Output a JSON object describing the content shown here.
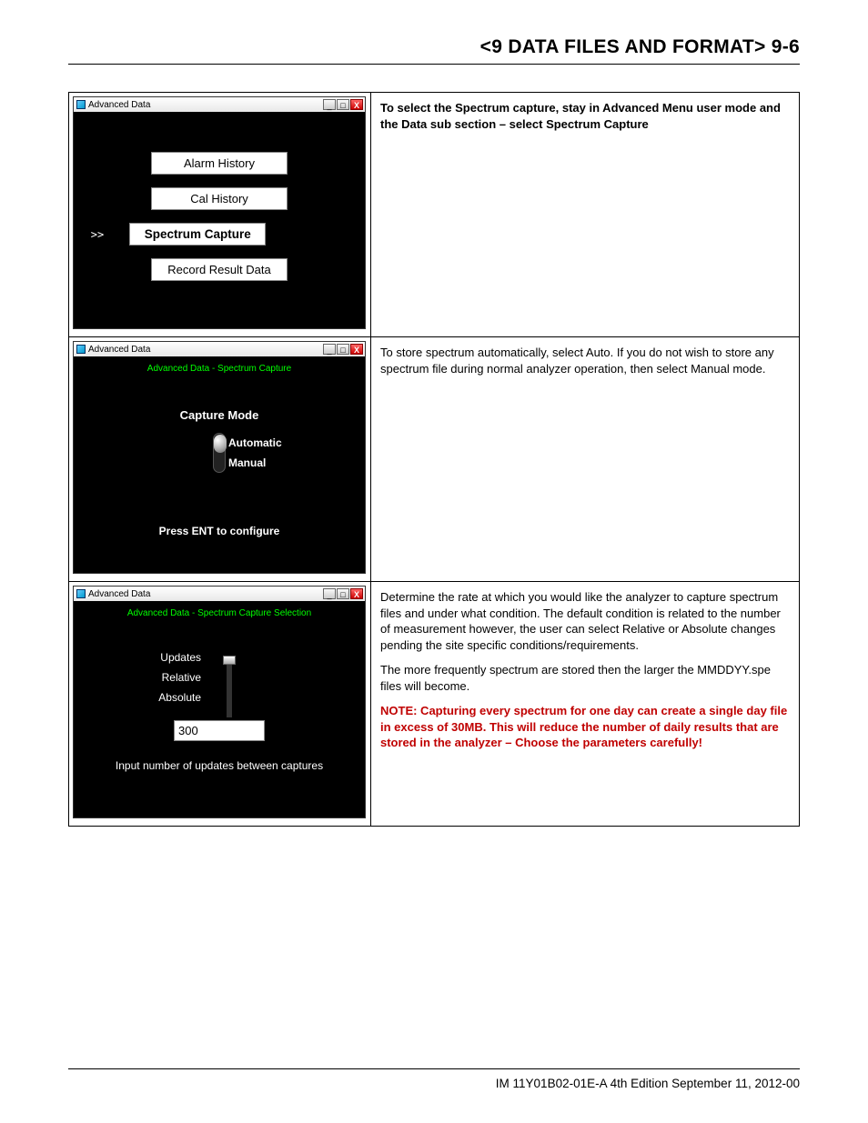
{
  "header": "<9 DATA FILES AND FORMAT>  9-6",
  "footer": "IM 11Y01B02-01E-A  4th Edition September 11, 2012-00",
  "win_title": "Advanced Data",
  "win_btn_min": "_",
  "win_btn_max": "□",
  "win_btn_close": "X",
  "row1": {
    "menu": {
      "item1": "Alarm History",
      "item2": "Cal History",
      "item3": "Spectrum Capture",
      "item4": "Record Result Data",
      "pointer": ">>"
    },
    "text": "To select the Spectrum capture, stay in Advanced Menu user mode and the Data sub section – select Spectrum Capture"
  },
  "row2": {
    "subheader": "Advanced Data - Spectrum Capture",
    "capture_mode_label": "Capture Mode",
    "opt_auto": "Automatic",
    "opt_manual": "Manual",
    "press_ent": "Press ENT to configure",
    "text": "To store spectrum automatically, select Auto. If you do not wish to store any spectrum file during normal analyzer operation, then select Manual mode."
  },
  "row3": {
    "subheader": "Advanced Data - Spectrum Capture Selection",
    "lbl_updates": "Updates",
    "lbl_relative": "Relative",
    "lbl_absolute": "Absolute",
    "num_value": "300",
    "caption": "Input number of updates between captures",
    "p1": "Determine the rate at which you would like the analyzer to capture spectrum files and under what condition. The default condition is related to the number of measurement however, the user can select Relative or Absolute changes pending the site specific conditions/requirements.",
    "p2": "The more frequently spectrum are stored then the larger the MMDDYY.spe files will become.",
    "note": "NOTE: Capturing every spectrum for one day can create a single day file in excess of 30MB.  This will reduce the number of daily results that are stored in the analyzer – Choose the parameters carefully!"
  }
}
